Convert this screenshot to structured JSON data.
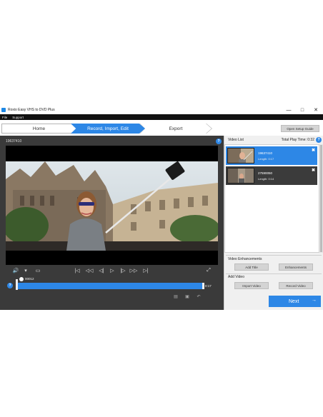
{
  "window": {
    "title": "Roxio Easy VHS to DVD Plus",
    "controls": {
      "minimize": "—",
      "maximize": "□",
      "close": "✕"
    }
  },
  "menu": [
    "File",
    "Support"
  ],
  "steps": {
    "home": "Home",
    "record": "Record, Import, Edit",
    "export": "Export"
  },
  "setup_guide_label": "Open Setup Guide",
  "player": {
    "clip_title": "19637410",
    "help": "?",
    "time_start": "00012",
    "time_end": "0:17",
    "controls": {
      "volume": "🔊",
      "dropdown": "▾",
      "aspect": "▭",
      "go_start": "|◁",
      "prev_mark": "◁◁",
      "step_back": "◁|",
      "play": "▷",
      "step_fwd": "|▷",
      "next_mark": "▷▷",
      "go_end": "▷|",
      "fullscreen": "⤢"
    }
  },
  "video_list": {
    "header": "Video List",
    "total_label": "Total Play Time: 0:32",
    "help": "?",
    "items": [
      {
        "name": "19637410",
        "length": "Length: 0:17",
        "close": "✖"
      },
      {
        "name": "27590050",
        "length": "Length: 0:14",
        "close": "✖"
      }
    ]
  },
  "enhancements": {
    "label": "Video Enhancements",
    "add_title": "Add Title",
    "enhancements": "Enhancements"
  },
  "add_video": {
    "label": "Add Video",
    "import": "Import Video",
    "record": "Record Video"
  },
  "next": {
    "label": "Next",
    "arrow": "→"
  },
  "colors": {
    "accent": "#2d87e6",
    "dark_panel": "#3a3a3a"
  }
}
